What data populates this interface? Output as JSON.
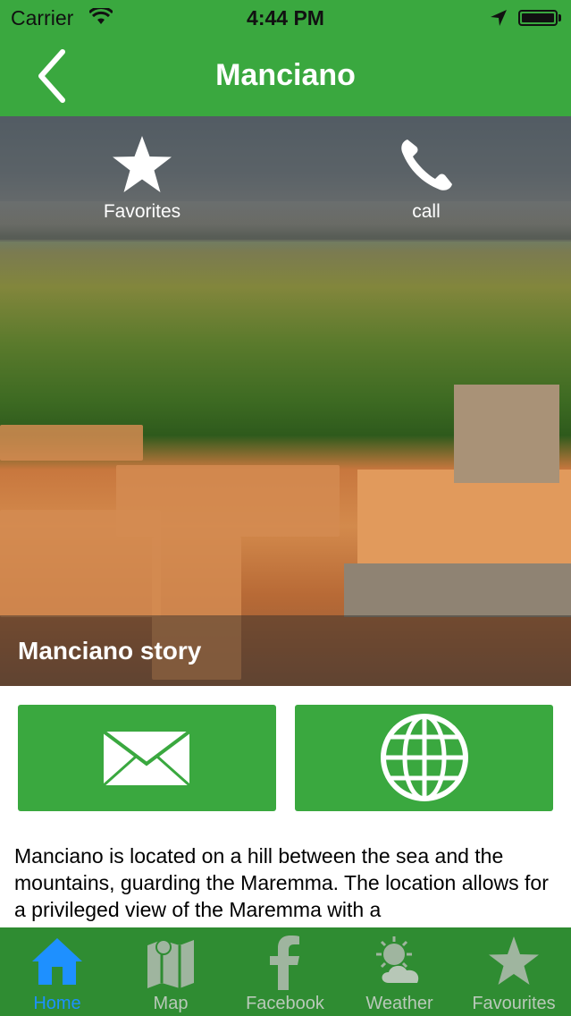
{
  "status_bar": {
    "carrier": "Carrier",
    "time": "4:44 PM"
  },
  "navbar": {
    "title": "Manciano",
    "back_icon": "chevron-left-icon"
  },
  "hero": {
    "favorites_label": "Favorites",
    "call_label": "call",
    "caption": "Manciano story"
  },
  "actions": {
    "mail_icon": "envelope-icon",
    "web_icon": "globe-icon"
  },
  "description": "Manciano is located on a hill between the sea and the mountains, guarding the Maremma. The location allows for a privileged view of the Maremma with a",
  "tabs": [
    {
      "label": "Home",
      "icon": "home-icon",
      "active": true
    },
    {
      "label": "Map",
      "icon": "map-icon",
      "active": false
    },
    {
      "label": "Facebook",
      "icon": "facebook-icon",
      "active": false
    },
    {
      "label": "Weather",
      "icon": "weather-icon",
      "active": false
    },
    {
      "label": "Favourites",
      "icon": "star-icon",
      "active": false
    }
  ],
  "colors": {
    "brand_green": "#3aa83f",
    "tab_green": "#2f8c32",
    "active_blue": "#1e90ff"
  }
}
